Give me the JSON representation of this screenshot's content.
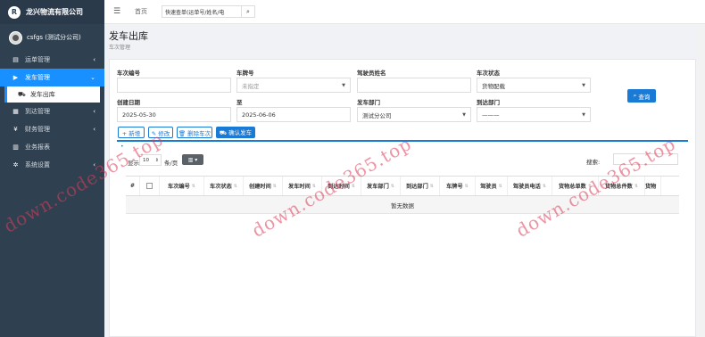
{
  "app": {
    "company": "龙兴物流有限公司",
    "logo_letter": "R"
  },
  "user": {
    "name": "csfgs (测试分公司)"
  },
  "sidebar": {
    "items": [
      {
        "label": "运单管理",
        "icon": "clipboard-icon",
        "glyph": "▤",
        "chevron": "‹"
      },
      {
        "label": "发车管理",
        "icon": "truck-icon",
        "glyph": "▶",
        "chevron": "⌄",
        "active": true
      },
      {
        "label": "到达管理",
        "icon": "building-icon",
        "glyph": "▦",
        "chevron": "‹"
      },
      {
        "label": "财务管理",
        "icon": "money-icon",
        "glyph": "¥",
        "chevron": "‹"
      },
      {
        "label": "业务报表",
        "icon": "table-icon",
        "glyph": "▥",
        "chevron": ""
      },
      {
        "label": "系统设置",
        "icon": "gear-icon",
        "glyph": "✲",
        "chevron": "‹"
      }
    ],
    "subitem": {
      "label": "发车出库",
      "glyph": "⛟"
    }
  },
  "topbar": {
    "menu_glyph": "☰",
    "home": "首页",
    "search_placeholder": "快速查单(运单号/姓名/电",
    "search_glyph": "⌕"
  },
  "page": {
    "title": "发车出库",
    "subtitle": "车次管理"
  },
  "form": {
    "trip_no": {
      "label": "车次编号",
      "value": ""
    },
    "plate": {
      "label": "车牌号",
      "value": "未指定"
    },
    "driver": {
      "label": "驾驶员姓名",
      "value": ""
    },
    "status": {
      "label": "车次状态",
      "value": "货物配载"
    },
    "created": {
      "label": "创建日期",
      "value": "2025-05-30"
    },
    "to": {
      "label": "至",
      "value": "2025-06-06"
    },
    "depart_dept": {
      "label": "发车部门",
      "value": "测试分公司"
    },
    "arrive_dept": {
      "label": "到达部门",
      "value": "———"
    },
    "query_button": "查询",
    "query_glyph": "⌕"
  },
  "toolbar": {
    "add": "+ 新增",
    "edit": "✎ 修改",
    "delete": "🗑 删除车次",
    "confirm": "⛟ 确认发车"
  },
  "table_controls": {
    "show_label": "显示",
    "page_size": "10",
    "per_page": "条/页",
    "columns_glyph": "▥ ▾",
    "search_label": "搜索:"
  },
  "table": {
    "headers": [
      "#",
      "",
      "车次编号",
      "车次状态",
      "创建时间",
      "发车时间",
      "到达时间",
      "发车部门",
      "到达部门",
      "车牌号",
      "驾驶员",
      "驾驶员电话",
      "货物总单数",
      "货物总件数",
      "货物"
    ],
    "sort_glyph": "⇅",
    "empty_text": "暂无数据"
  },
  "watermark": "down.code365.top"
}
